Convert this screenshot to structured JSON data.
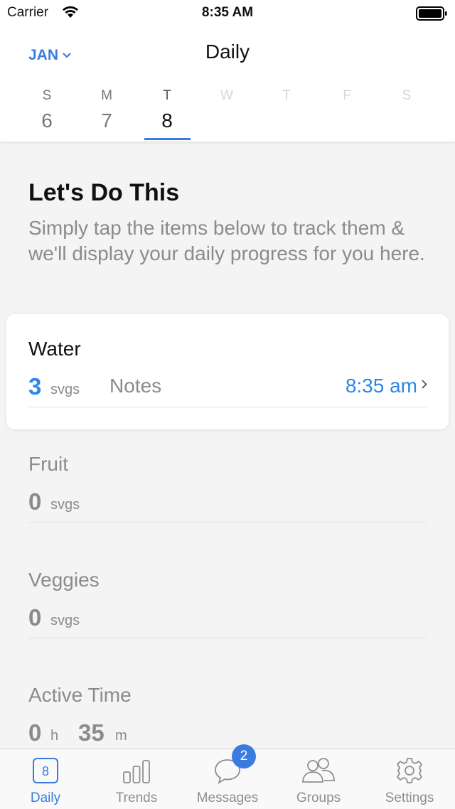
{
  "status_bar": {
    "carrier": "Carrier",
    "time": "8:35 AM"
  },
  "header": {
    "month": "JAN",
    "title": "Daily",
    "days": [
      {
        "letter": "S",
        "number": "6"
      },
      {
        "letter": "M",
        "number": "7"
      },
      {
        "letter": "T",
        "number": "8"
      },
      {
        "letter": "W",
        "number": ""
      },
      {
        "letter": "T",
        "number": ""
      },
      {
        "letter": "F",
        "number": ""
      },
      {
        "letter": "S",
        "number": ""
      }
    ],
    "selected_day_index": 2
  },
  "intro": {
    "title": "Let's Do This",
    "text": "Simply tap the items below to track them & we'll display your daily progress for you here."
  },
  "water": {
    "name": "Water",
    "count": "3",
    "unit": "svgs",
    "notes": "Notes",
    "time": "8:35 am"
  },
  "fruit": {
    "name": "Fruit",
    "count": "0",
    "unit": "svgs"
  },
  "veggies": {
    "name": "Veggies",
    "count": "0",
    "unit": "svgs"
  },
  "active_time": {
    "name": "Active Time",
    "hours": "0",
    "hours_unit": "h",
    "minutes": "35",
    "minutes_unit": "m"
  },
  "tabbar": {
    "daily_icon_number": "8",
    "tabs": [
      {
        "label": "Daily",
        "icon": "calendar-day-icon"
      },
      {
        "label": "Trends",
        "icon": "bar-chart-icon"
      },
      {
        "label": "Messages",
        "icon": "chat-bubble-icon"
      },
      {
        "label": "Groups",
        "icon": "people-icon"
      },
      {
        "label": "Settings",
        "icon": "gear-icon"
      }
    ],
    "messages_badge": "2"
  },
  "colors": {
    "accent": "#3a7be0",
    "link_blue": "#2d86e8",
    "muted": "#8b8b8b"
  }
}
